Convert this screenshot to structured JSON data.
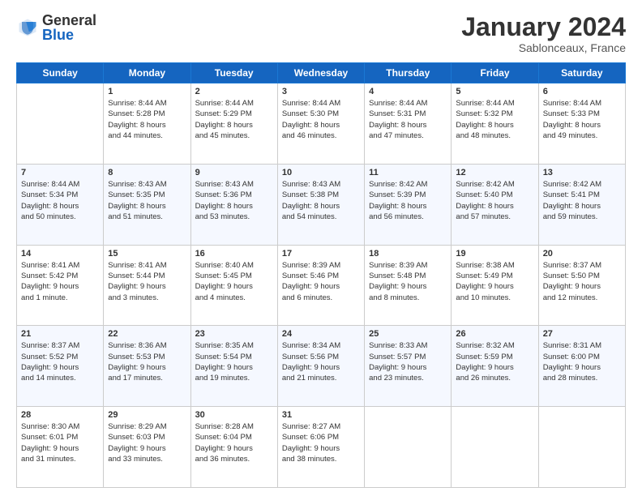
{
  "header": {
    "logo_general": "General",
    "logo_blue": "Blue",
    "month_title": "January 2024",
    "location": "Sablonceaux, France"
  },
  "calendar": {
    "days": [
      "Sunday",
      "Monday",
      "Tuesday",
      "Wednesday",
      "Thursday",
      "Friday",
      "Saturday"
    ],
    "weeks": [
      [
        {
          "day": "",
          "info": ""
        },
        {
          "day": "1",
          "info": "Sunrise: 8:44 AM\nSunset: 5:28 PM\nDaylight: 8 hours\nand 44 minutes."
        },
        {
          "day": "2",
          "info": "Sunrise: 8:44 AM\nSunset: 5:29 PM\nDaylight: 8 hours\nand 45 minutes."
        },
        {
          "day": "3",
          "info": "Sunrise: 8:44 AM\nSunset: 5:30 PM\nDaylight: 8 hours\nand 46 minutes."
        },
        {
          "day": "4",
          "info": "Sunrise: 8:44 AM\nSunset: 5:31 PM\nDaylight: 8 hours\nand 47 minutes."
        },
        {
          "day": "5",
          "info": "Sunrise: 8:44 AM\nSunset: 5:32 PM\nDaylight: 8 hours\nand 48 minutes."
        },
        {
          "day": "6",
          "info": "Sunrise: 8:44 AM\nSunset: 5:33 PM\nDaylight: 8 hours\nand 49 minutes."
        }
      ],
      [
        {
          "day": "7",
          "info": "Sunrise: 8:44 AM\nSunset: 5:34 PM\nDaylight: 8 hours\nand 50 minutes."
        },
        {
          "day": "8",
          "info": "Sunrise: 8:43 AM\nSunset: 5:35 PM\nDaylight: 8 hours\nand 51 minutes."
        },
        {
          "day": "9",
          "info": "Sunrise: 8:43 AM\nSunset: 5:36 PM\nDaylight: 8 hours\nand 53 minutes."
        },
        {
          "day": "10",
          "info": "Sunrise: 8:43 AM\nSunset: 5:38 PM\nDaylight: 8 hours\nand 54 minutes."
        },
        {
          "day": "11",
          "info": "Sunrise: 8:42 AM\nSunset: 5:39 PM\nDaylight: 8 hours\nand 56 minutes."
        },
        {
          "day": "12",
          "info": "Sunrise: 8:42 AM\nSunset: 5:40 PM\nDaylight: 8 hours\nand 57 minutes."
        },
        {
          "day": "13",
          "info": "Sunrise: 8:42 AM\nSunset: 5:41 PM\nDaylight: 8 hours\nand 59 minutes."
        }
      ],
      [
        {
          "day": "14",
          "info": "Sunrise: 8:41 AM\nSunset: 5:42 PM\nDaylight: 9 hours\nand 1 minute."
        },
        {
          "day": "15",
          "info": "Sunrise: 8:41 AM\nSunset: 5:44 PM\nDaylight: 9 hours\nand 3 minutes."
        },
        {
          "day": "16",
          "info": "Sunrise: 8:40 AM\nSunset: 5:45 PM\nDaylight: 9 hours\nand 4 minutes."
        },
        {
          "day": "17",
          "info": "Sunrise: 8:39 AM\nSunset: 5:46 PM\nDaylight: 9 hours\nand 6 minutes."
        },
        {
          "day": "18",
          "info": "Sunrise: 8:39 AM\nSunset: 5:48 PM\nDaylight: 9 hours\nand 8 minutes."
        },
        {
          "day": "19",
          "info": "Sunrise: 8:38 AM\nSunset: 5:49 PM\nDaylight: 9 hours\nand 10 minutes."
        },
        {
          "day": "20",
          "info": "Sunrise: 8:37 AM\nSunset: 5:50 PM\nDaylight: 9 hours\nand 12 minutes."
        }
      ],
      [
        {
          "day": "21",
          "info": "Sunrise: 8:37 AM\nSunset: 5:52 PM\nDaylight: 9 hours\nand 14 minutes."
        },
        {
          "day": "22",
          "info": "Sunrise: 8:36 AM\nSunset: 5:53 PM\nDaylight: 9 hours\nand 17 minutes."
        },
        {
          "day": "23",
          "info": "Sunrise: 8:35 AM\nSunset: 5:54 PM\nDaylight: 9 hours\nand 19 minutes."
        },
        {
          "day": "24",
          "info": "Sunrise: 8:34 AM\nSunset: 5:56 PM\nDaylight: 9 hours\nand 21 minutes."
        },
        {
          "day": "25",
          "info": "Sunrise: 8:33 AM\nSunset: 5:57 PM\nDaylight: 9 hours\nand 23 minutes."
        },
        {
          "day": "26",
          "info": "Sunrise: 8:32 AM\nSunset: 5:59 PM\nDaylight: 9 hours\nand 26 minutes."
        },
        {
          "day": "27",
          "info": "Sunrise: 8:31 AM\nSunset: 6:00 PM\nDaylight: 9 hours\nand 28 minutes."
        }
      ],
      [
        {
          "day": "28",
          "info": "Sunrise: 8:30 AM\nSunset: 6:01 PM\nDaylight: 9 hours\nand 31 minutes."
        },
        {
          "day": "29",
          "info": "Sunrise: 8:29 AM\nSunset: 6:03 PM\nDaylight: 9 hours\nand 33 minutes."
        },
        {
          "day": "30",
          "info": "Sunrise: 8:28 AM\nSunset: 6:04 PM\nDaylight: 9 hours\nand 36 minutes."
        },
        {
          "day": "31",
          "info": "Sunrise: 8:27 AM\nSunset: 6:06 PM\nDaylight: 9 hours\nand 38 minutes."
        },
        {
          "day": "",
          "info": ""
        },
        {
          "day": "",
          "info": ""
        },
        {
          "day": "",
          "info": ""
        }
      ]
    ]
  }
}
